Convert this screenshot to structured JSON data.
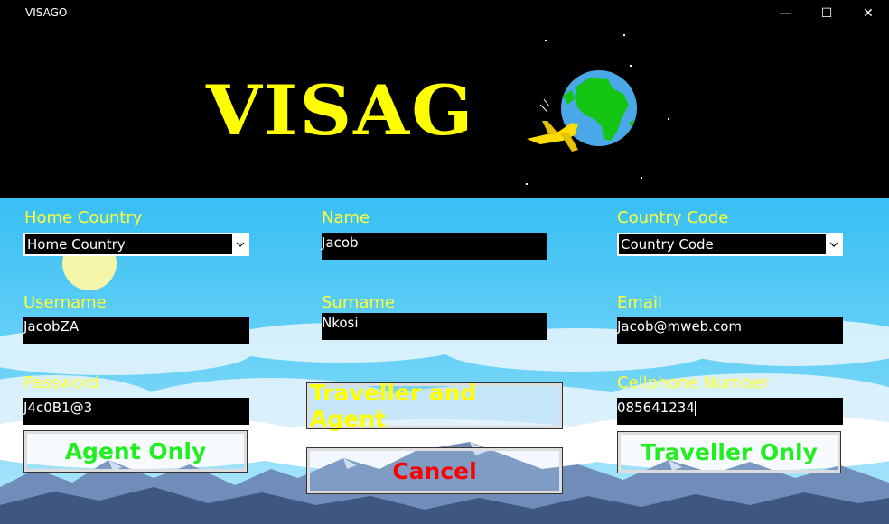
{
  "window": {
    "title": "VISAGO",
    "minimize_glyph": "—",
    "maximize_glyph": "☐",
    "close_glyph": "✕"
  },
  "logo": {
    "text": "VISAG",
    "icon": "globe-with-airplane"
  },
  "form": {
    "home_country": {
      "label": "Home Country",
      "value": "Home Country"
    },
    "name": {
      "label": "Name",
      "value": "Jacob"
    },
    "country_code": {
      "label": "Country Code",
      "value": "Country Code"
    },
    "username": {
      "label": "Username",
      "value": "JacobZA"
    },
    "surname": {
      "label": "Surname",
      "value": "Nkosi"
    },
    "email": {
      "label": "Email",
      "value": "Jacob@mweb.com"
    },
    "password": {
      "label": "Password",
      "value": "J4c0B1@3"
    },
    "cellphone": {
      "label": "Cellphone Number",
      "value": "085641234"
    }
  },
  "buttons": {
    "agent_only": "Agent Only",
    "traveller_and_agent": "Traveller and Agent",
    "traveller_only": "Traveller Only",
    "cancel": "Cancel"
  },
  "colors": {
    "label": "#ffff33",
    "logo": "#ffff00",
    "green_button_text": "#22ee22",
    "yellow_button_text": "#ffff00",
    "cancel_text": "#ff0000",
    "sky": "#3ec3f2"
  }
}
